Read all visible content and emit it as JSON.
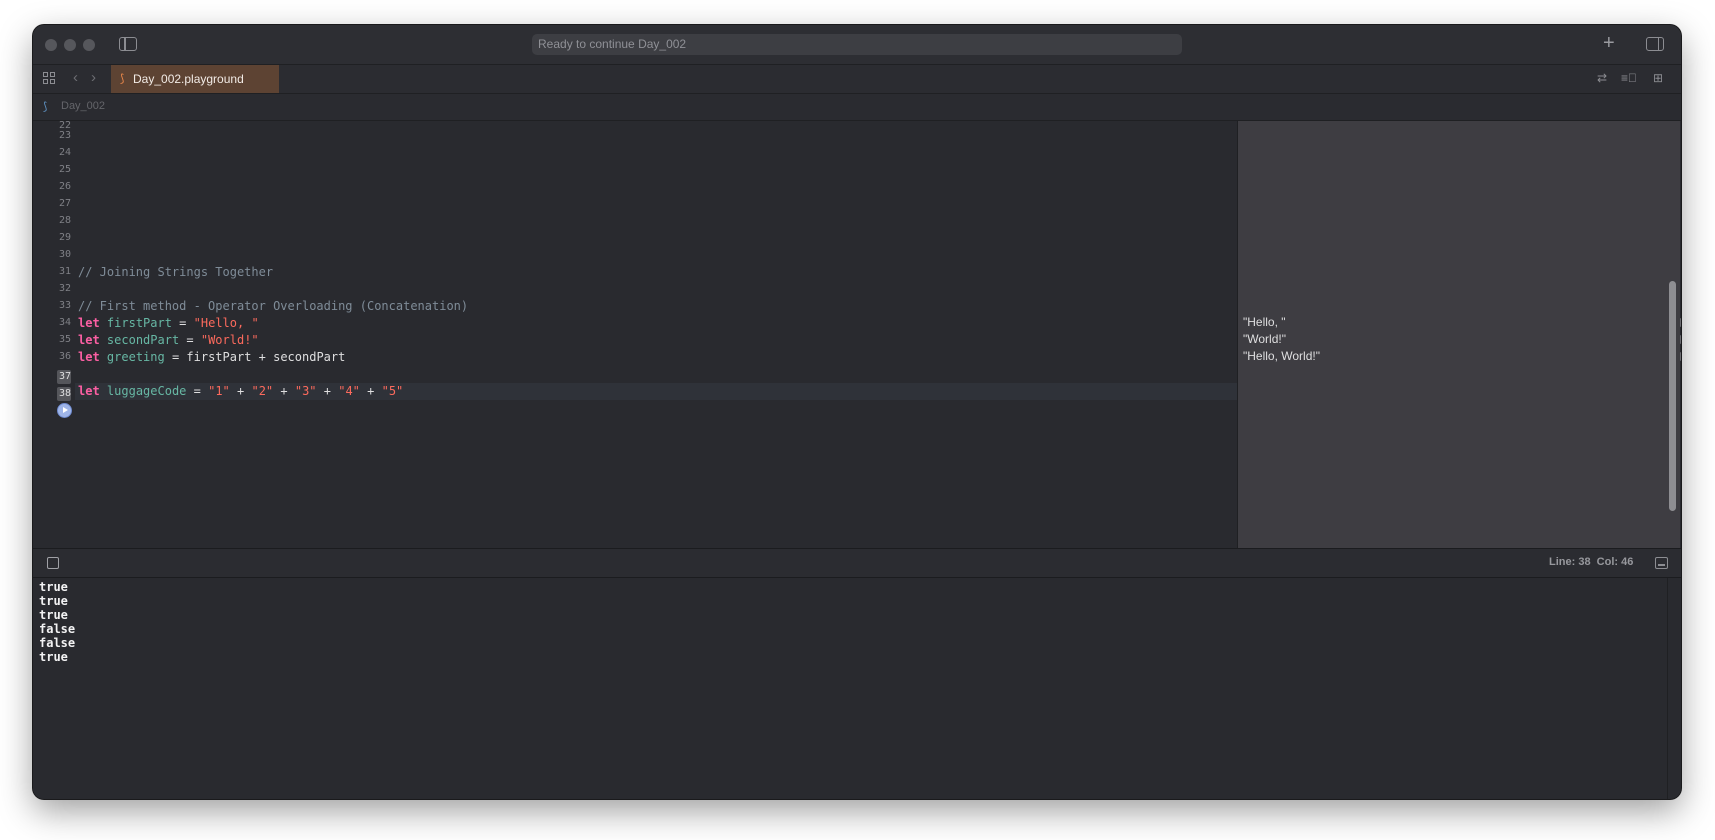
{
  "toolbar": {
    "activity": "Ready to continue Day_002"
  },
  "tabs": [
    {
      "label": "Day_002.playground"
    }
  ],
  "jumpbar": {
    "item": "Day_002"
  },
  "editor": {
    "lines": [
      {
        "n": "22"
      },
      {
        "n": "23"
      },
      {
        "n": "24"
      },
      {
        "n": "25"
      },
      {
        "n": "26"
      },
      {
        "n": "27"
      },
      {
        "n": "28"
      },
      {
        "n": "29"
      },
      {
        "n": "30"
      },
      {
        "n": "31"
      },
      {
        "n": "32"
      },
      {
        "n": "33"
      },
      {
        "n": "34"
      },
      {
        "n": "35"
      },
      {
        "n": "36"
      },
      {
        "n": "37"
      },
      {
        "n": "38"
      }
    ],
    "code": {
      "c31": "// Joining Strings Together",
      "c33": "// First method - Operator Overloading (Concatenation)",
      "let": "let",
      "first_name": "firstPart",
      "first_str": "\"Hello, \"",
      "second_name": "secondPart",
      "second_str": "\"World!\"",
      "greeting_name": "greeting",
      "greeting_expr": "firstPart + secondPart",
      "luggage_name": "luggageCode",
      "eq": " = ",
      "plus": " + ",
      "s1": "\"1\"",
      "s2": "\"2\"",
      "s3": "\"3\"",
      "s4": "\"4\"",
      "s5": "\"5\""
    }
  },
  "results": [
    "\"Hello, \"",
    "\"World!\"",
    "\"Hello, World!\""
  ],
  "status": {
    "line_col": "Line: 38  Col: 46"
  },
  "console": [
    "true",
    "true",
    "true",
    "false",
    "false",
    "true"
  ]
}
